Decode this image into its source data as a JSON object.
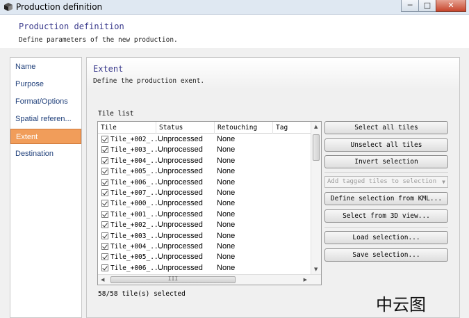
{
  "window": {
    "title": "Production definition",
    "min": "─",
    "max": "□",
    "close": "✕"
  },
  "header": {
    "title": "Production definition",
    "subtitle": "Define parameters of the new production."
  },
  "sidebar": {
    "items": [
      {
        "label": "Name"
      },
      {
        "label": "Purpose"
      },
      {
        "label": "Format/Options"
      },
      {
        "label": "Spatial referen..."
      },
      {
        "label": "Extent"
      },
      {
        "label": "Destination"
      }
    ],
    "active_index": 4
  },
  "main": {
    "title": "Extent",
    "subtitle": "Define the production exent.",
    "tile_list_label": "Tile list",
    "columns": [
      "Tile",
      "Status",
      "Retouching",
      "Tag"
    ],
    "rows": [
      {
        "tile": "Tile_+002_...",
        "status": "Unprocessed",
        "retouching": "None"
      },
      {
        "tile": "Tile_+003_...",
        "status": "Unprocessed",
        "retouching": "None"
      },
      {
        "tile": "Tile_+004_...",
        "status": "Unprocessed",
        "retouching": "None"
      },
      {
        "tile": "Tile_+005_...",
        "status": "Unprocessed",
        "retouching": "None"
      },
      {
        "tile": "Tile_+006_...",
        "status": "Unprocessed",
        "retouching": "None"
      },
      {
        "tile": "Tile_+007_...",
        "status": "Unprocessed",
        "retouching": "None"
      },
      {
        "tile": "Tile_+000_...",
        "status": "Unprocessed",
        "retouching": "None"
      },
      {
        "tile": "Tile_+001_...",
        "status": "Unprocessed",
        "retouching": "None"
      },
      {
        "tile": "Tile_+002_...",
        "status": "Unprocessed",
        "retouching": "None"
      },
      {
        "tile": "Tile_+003_...",
        "status": "Unprocessed",
        "retouching": "None"
      },
      {
        "tile": "Tile_+004_...",
        "status": "Unprocessed",
        "retouching": "None"
      },
      {
        "tile": "Tile_+005_...",
        "status": "Unprocessed",
        "retouching": "None"
      },
      {
        "tile": "Tile_+006_...",
        "status": "Unprocessed",
        "retouching": "None"
      }
    ],
    "hscroll_grip": "III",
    "selection_count": "58/58 tile(s) selected"
  },
  "buttons": {
    "select_all": "Select all tiles",
    "unselect_all": "Unselect all tiles",
    "invert": "Invert selection",
    "add_tagged_placeholder": "Add tagged tiles to selection",
    "define_from_kml": "Define selection from KML...",
    "select_from_3d": "Select from 3D view...",
    "load_selection": "Load selection...",
    "save_selection": "Save selection..."
  },
  "watermark": "中云图",
  "colors": {
    "active_nav": "#f19d5a",
    "heading": "#3a3a8c",
    "nav_text": "#1f3f7a"
  }
}
